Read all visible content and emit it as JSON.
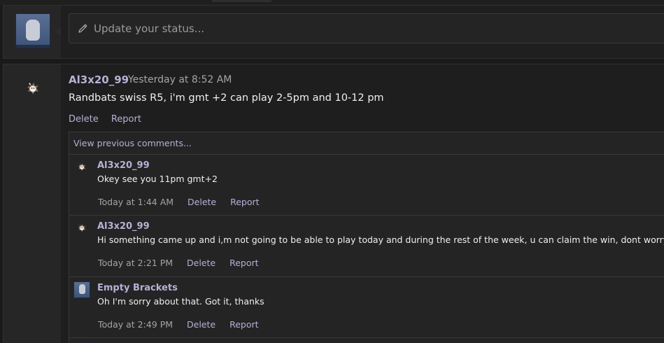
{
  "status": {
    "placeholder": "Update your status..."
  },
  "post": {
    "author": "Al3x20_99",
    "time": "· Yesterday at 8:52 AM",
    "text": "Randbats swiss R5, i'm gmt +2 can play 2-5pm and 10-12 pm",
    "actions": {
      "delete": "Delete",
      "report": "Report"
    }
  },
  "comments": {
    "view_previous": "View previous comments...",
    "items": [
      {
        "author": "Al3x20_99",
        "text": "Okey see you 11pm gmt+2",
        "time": "Today at 1:44 AM",
        "delete": "Delete",
        "report": "Report"
      },
      {
        "author": "Al3x20_99",
        "text": "Hi something came up and i,m not going to be able to play today and during the rest of the week, u can claim the win, dont worry",
        "time": "Today at 2:21 PM",
        "delete": "Delete",
        "report": "Report"
      },
      {
        "author": "Empty Brackets",
        "text": "Oh I'm sorry about that. Got it, thanks",
        "time": "Today at 2:49 PM",
        "delete": "Delete",
        "report": "Report"
      }
    ]
  },
  "colors": {
    "accent": "#b9afd6",
    "background": "#1a1a1a",
    "panel": "#262626"
  },
  "icons": {
    "status_edit": "pencil-icon",
    "user_avatar": "avatar"
  }
}
